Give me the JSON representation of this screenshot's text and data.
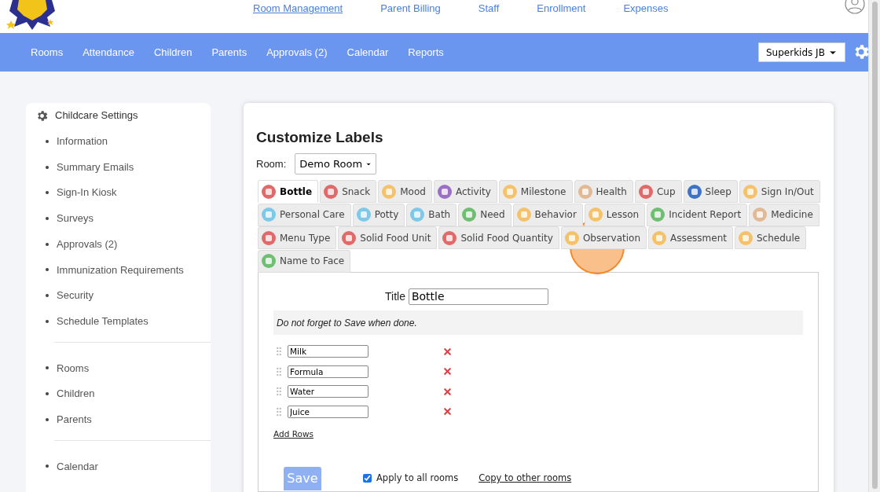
{
  "top_links": [
    {
      "label": "Room Management",
      "selected": true
    },
    {
      "label": "Parent Billing",
      "selected": false
    },
    {
      "label": "Staff",
      "selected": false
    },
    {
      "label": "Enrollment",
      "selected": false
    },
    {
      "label": "Expenses",
      "selected": false
    }
  ],
  "nav": [
    "Rooms",
    "Attendance",
    "Children",
    "Parents",
    "Approvals (2)",
    "Calendar",
    "Reports"
  ],
  "school_select": "Superkids JB",
  "sidebar": {
    "title": "Childcare Settings",
    "groups": [
      [
        "Information",
        "Summary Emails",
        "Sign-In Kiosk",
        "Surveys",
        "Approvals (2)",
        "Immunization Requirements",
        "Security",
        "Schedule Templates"
      ],
      [
        "Rooms",
        "Children",
        "Parents"
      ],
      [
        "Calendar"
      ]
    ]
  },
  "page_title": "Customize Labels",
  "room_label": "Room:",
  "room_select": "Demo Room",
  "tab_rows": [
    [
      {
        "label": "Bottle",
        "selected": true,
        "color": "#e06a6a"
      },
      {
        "label": "Snack",
        "selected": false,
        "color": "#e06a6a"
      },
      {
        "label": "Mood",
        "selected": false,
        "color": "#f5c26b"
      },
      {
        "label": "Activity",
        "selected": false,
        "color": "#9b6fc4"
      },
      {
        "label": "Milestone",
        "selected": false,
        "color": "#f5c26b"
      },
      {
        "label": "Health",
        "selected": false,
        "color": "#e2b995"
      },
      {
        "label": "Cup",
        "selected": false,
        "color": "#e06a6a"
      },
      {
        "label": "Sleep",
        "selected": false,
        "color": "#3f72c4"
      },
      {
        "label": "Sign In/Out",
        "selected": false,
        "color": "#f5c26b"
      }
    ],
    [
      {
        "label": "Personal Care",
        "selected": false,
        "color": "#7ec8ea"
      },
      {
        "label": "Potty",
        "selected": false,
        "color": "#7ec8ea"
      },
      {
        "label": "Bath",
        "selected": false,
        "color": "#7ec8ea"
      },
      {
        "label": "Need",
        "selected": false,
        "color": "#6fbf73"
      },
      {
        "label": "Behavior",
        "selected": false,
        "color": "#f5c26b"
      },
      {
        "label": "Lesson",
        "selected": false,
        "color": "#f5c26b"
      },
      {
        "label": "Incident Report",
        "selected": false,
        "color": "#6fbf73"
      },
      {
        "label": "Medicine",
        "selected": false,
        "color": "#e2b995"
      }
    ],
    [
      {
        "label": "Menu Type",
        "selected": false,
        "color": "#e06a6a"
      },
      {
        "label": "Solid Food Unit",
        "selected": false,
        "color": "#e06a6a"
      },
      {
        "label": "Solid Food Quantity",
        "selected": false,
        "color": "#e06a6a"
      },
      {
        "label": "Observation",
        "selected": false,
        "color": "#f5c26b"
      },
      {
        "label": "Assessment",
        "selected": false,
        "color": "#f5c26b"
      },
      {
        "label": "Schedule",
        "selected": false,
        "color": "#f5c26b"
      }
    ],
    [
      {
        "label": "Name to Face",
        "selected": false,
        "color": "#6fbf73"
      }
    ]
  ],
  "title_label": "Title",
  "title_value": "Bottle",
  "note": "Do not forget to Save when done.",
  "rows": [
    "Milk",
    "Formula",
    "Water",
    "Juice"
  ],
  "add_rows": "Add Rows",
  "save": "Save",
  "apply_all": {
    "label": "Apply to all rooms",
    "checked": true
  },
  "copy_link": "Copy to other rooms"
}
